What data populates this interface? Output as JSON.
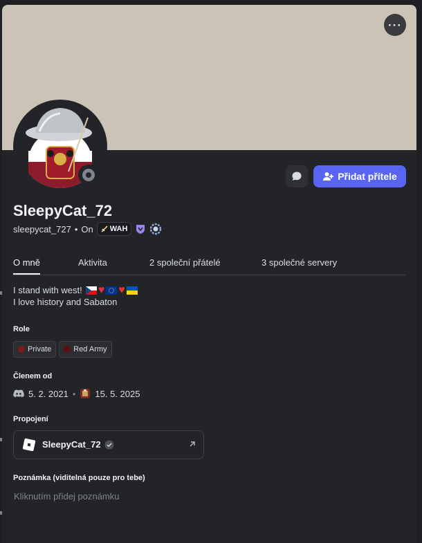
{
  "profile": {
    "display_name": "SleepyCat_72",
    "username": "sleepycat_727",
    "pronouns": "On",
    "guild_tag": "WAH"
  },
  "header": {
    "more_label": "···",
    "add_friend_label": "Přidat přítele"
  },
  "tabs": [
    "O mně",
    "Aktivita",
    "2 společní přátelé",
    "3 společné servery"
  ],
  "bio": {
    "line1": "I stand with west!",
    "line2": "I love history and Sabaton"
  },
  "roles": {
    "title": "Role",
    "items": [
      {
        "label": "Private",
        "color": "#7a1c22"
      },
      {
        "label": "Red Army",
        "color": "#5c0f12"
      }
    ]
  },
  "member_since": {
    "title": "Členem od",
    "discord_date": "5. 2. 2021",
    "server_date": "15. 5. 2025"
  },
  "connections": {
    "title": "Propojení",
    "account_name": "SleepyCat_72"
  },
  "note": {
    "title": "Poznámka (viditelná pouze pro tebe)",
    "placeholder": "Kliknutím přidej poznámku"
  },
  "colors": {
    "banner": "#cac3b6",
    "accent": "#5865f2",
    "card": "#232428",
    "status_offline": "#80848e"
  },
  "icons": [
    "more-icon",
    "message-icon",
    "add-friend-icon",
    "sword-icon",
    "hypesquad-badge-icon",
    "nitro-badge-icon",
    "discord-icon",
    "server-icon",
    "roblox-icon",
    "verified-icon",
    "external-link-icon"
  ]
}
